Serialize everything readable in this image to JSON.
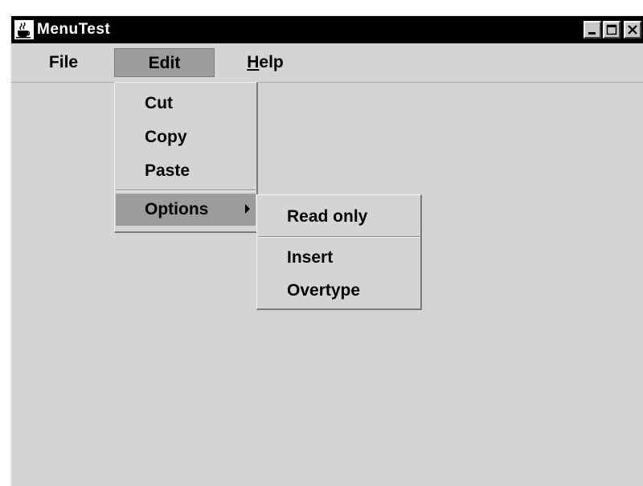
{
  "window": {
    "title": "MenuTest"
  },
  "menubar": {
    "file": "File",
    "edit": "Edit",
    "help_mnemonic": "H",
    "help_rest": "elp"
  },
  "edit_menu": {
    "cut": "Cut",
    "copy": "Copy",
    "paste": "Paste",
    "options": "Options"
  },
  "options_submenu": {
    "read_only": "Read only",
    "insert": "Insert",
    "overtype": "Overtype"
  },
  "icons": {
    "app": "java-cup-icon",
    "minimize": "minimize-icon",
    "maximize": "maximize-icon",
    "close": "close-icon",
    "submenu": "submenu-arrow-icon"
  }
}
